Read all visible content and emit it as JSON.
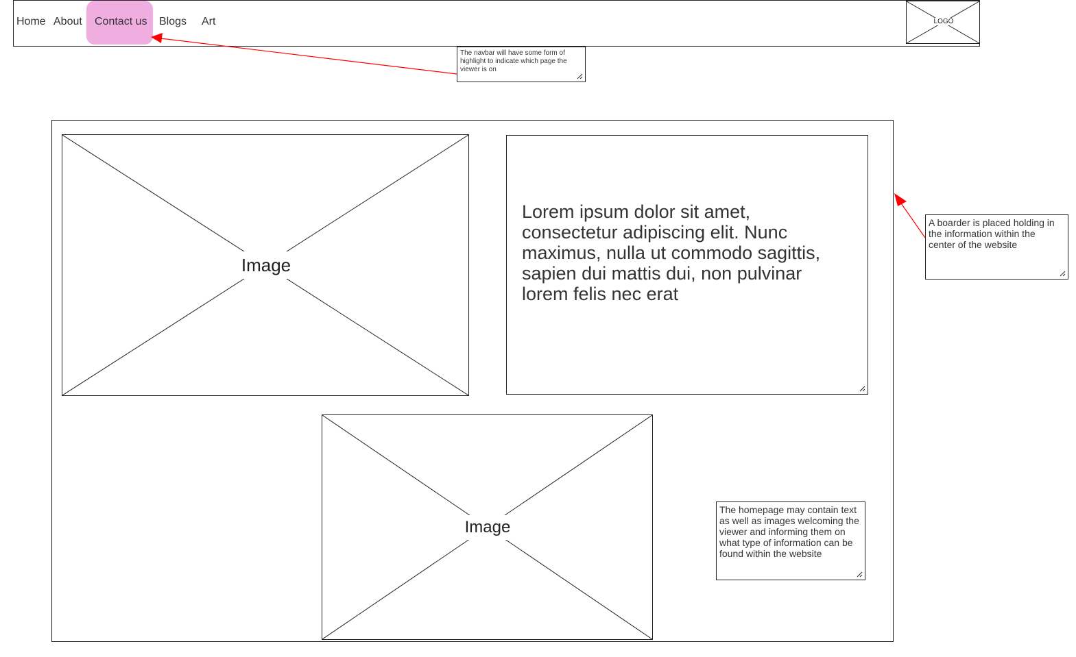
{
  "navbar": {
    "items": [
      "Home",
      "About",
      "Contact us",
      "Blogs",
      "Art"
    ],
    "active_item": "Contact us",
    "highlight_color": "#f0aee0",
    "logo_label": "LOGO"
  },
  "main": {
    "image_label_1": "Image",
    "image_label_2": "Image",
    "lorem_text": "Lorem ipsum dolor sit amet, consectetur adipiscing elit. Nunc maximus, nulla ut commodo sagittis, sapien dui mattis dui, non pulvinar lorem felis nec erat"
  },
  "notes": {
    "navbar_note": "The navbar will have some form of highlight to indicate which page the viewer is on",
    "border_note": "A boarder is placed holding in the information within the center of the website",
    "homepage_note": "The homepage may contain text as well as images welcoming the viewer and informing them on what type of information can be found within the website"
  },
  "colors": {
    "arrow": "#ff0000",
    "line": "#222222"
  }
}
